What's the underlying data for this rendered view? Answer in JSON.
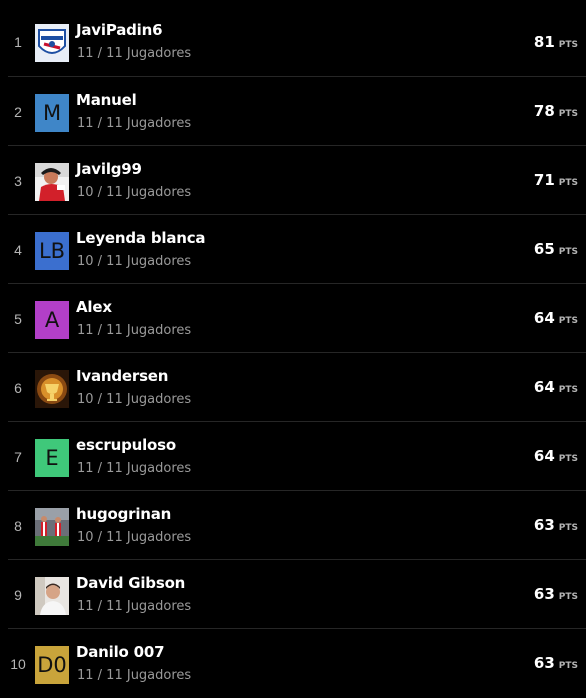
{
  "ranking": {
    "points_unit": "PTS",
    "rows": [
      {
        "rank": "1",
        "name": "JaviPadin6",
        "players": "11 / 11 Jugadores",
        "points": "81",
        "avatar": {
          "type": "image",
          "icon": "club-crest-icon"
        }
      },
      {
        "rank": "2",
        "name": "Manuel",
        "players": "11 / 11 Jugadores",
        "points": "78",
        "avatar": {
          "type": "initials",
          "text": "M",
          "color": "#3f86c8"
        }
      },
      {
        "rank": "3",
        "name": "Javilg99",
        "players": "10 / 11 Jugadores",
        "points": "71",
        "avatar": {
          "type": "image",
          "icon": "player-photo-icon"
        }
      },
      {
        "rank": "4",
        "name": "Leyenda blanca",
        "players": "10 / 11 Jugadores",
        "points": "65",
        "avatar": {
          "type": "initials",
          "text": "LB",
          "color": "#3b6fcf"
        }
      },
      {
        "rank": "5",
        "name": "Alex",
        "players": "11 / 11 Jugadores",
        "points": "64",
        "avatar": {
          "type": "initials",
          "text": "A",
          "color": "#b23fc8"
        }
      },
      {
        "rank": "6",
        "name": "Ivandersen",
        "players": "10 / 11 Jugadores",
        "points": "64",
        "avatar": {
          "type": "image",
          "icon": "trophy-emblem-icon"
        }
      },
      {
        "rank": "7",
        "name": "escrupuloso",
        "players": "11 / 11 Jugadores",
        "points": "64",
        "avatar": {
          "type": "initials",
          "text": "E",
          "color": "#3fc87a"
        }
      },
      {
        "rank": "8",
        "name": "hugogrinan",
        "players": "10 / 11 Jugadores",
        "points": "63",
        "avatar": {
          "type": "image",
          "icon": "stadium-photo-icon"
        }
      },
      {
        "rank": "9",
        "name": "David Gibson",
        "players": "11 / 11 Jugadores",
        "points": "63",
        "avatar": {
          "type": "image",
          "icon": "person-photo-icon"
        }
      },
      {
        "rank": "10",
        "name": "Danilo 007",
        "players": "11 / 11 Jugadores",
        "points": "63",
        "avatar": {
          "type": "initials",
          "text": "D0",
          "color": "#c9a43b"
        }
      }
    ]
  }
}
